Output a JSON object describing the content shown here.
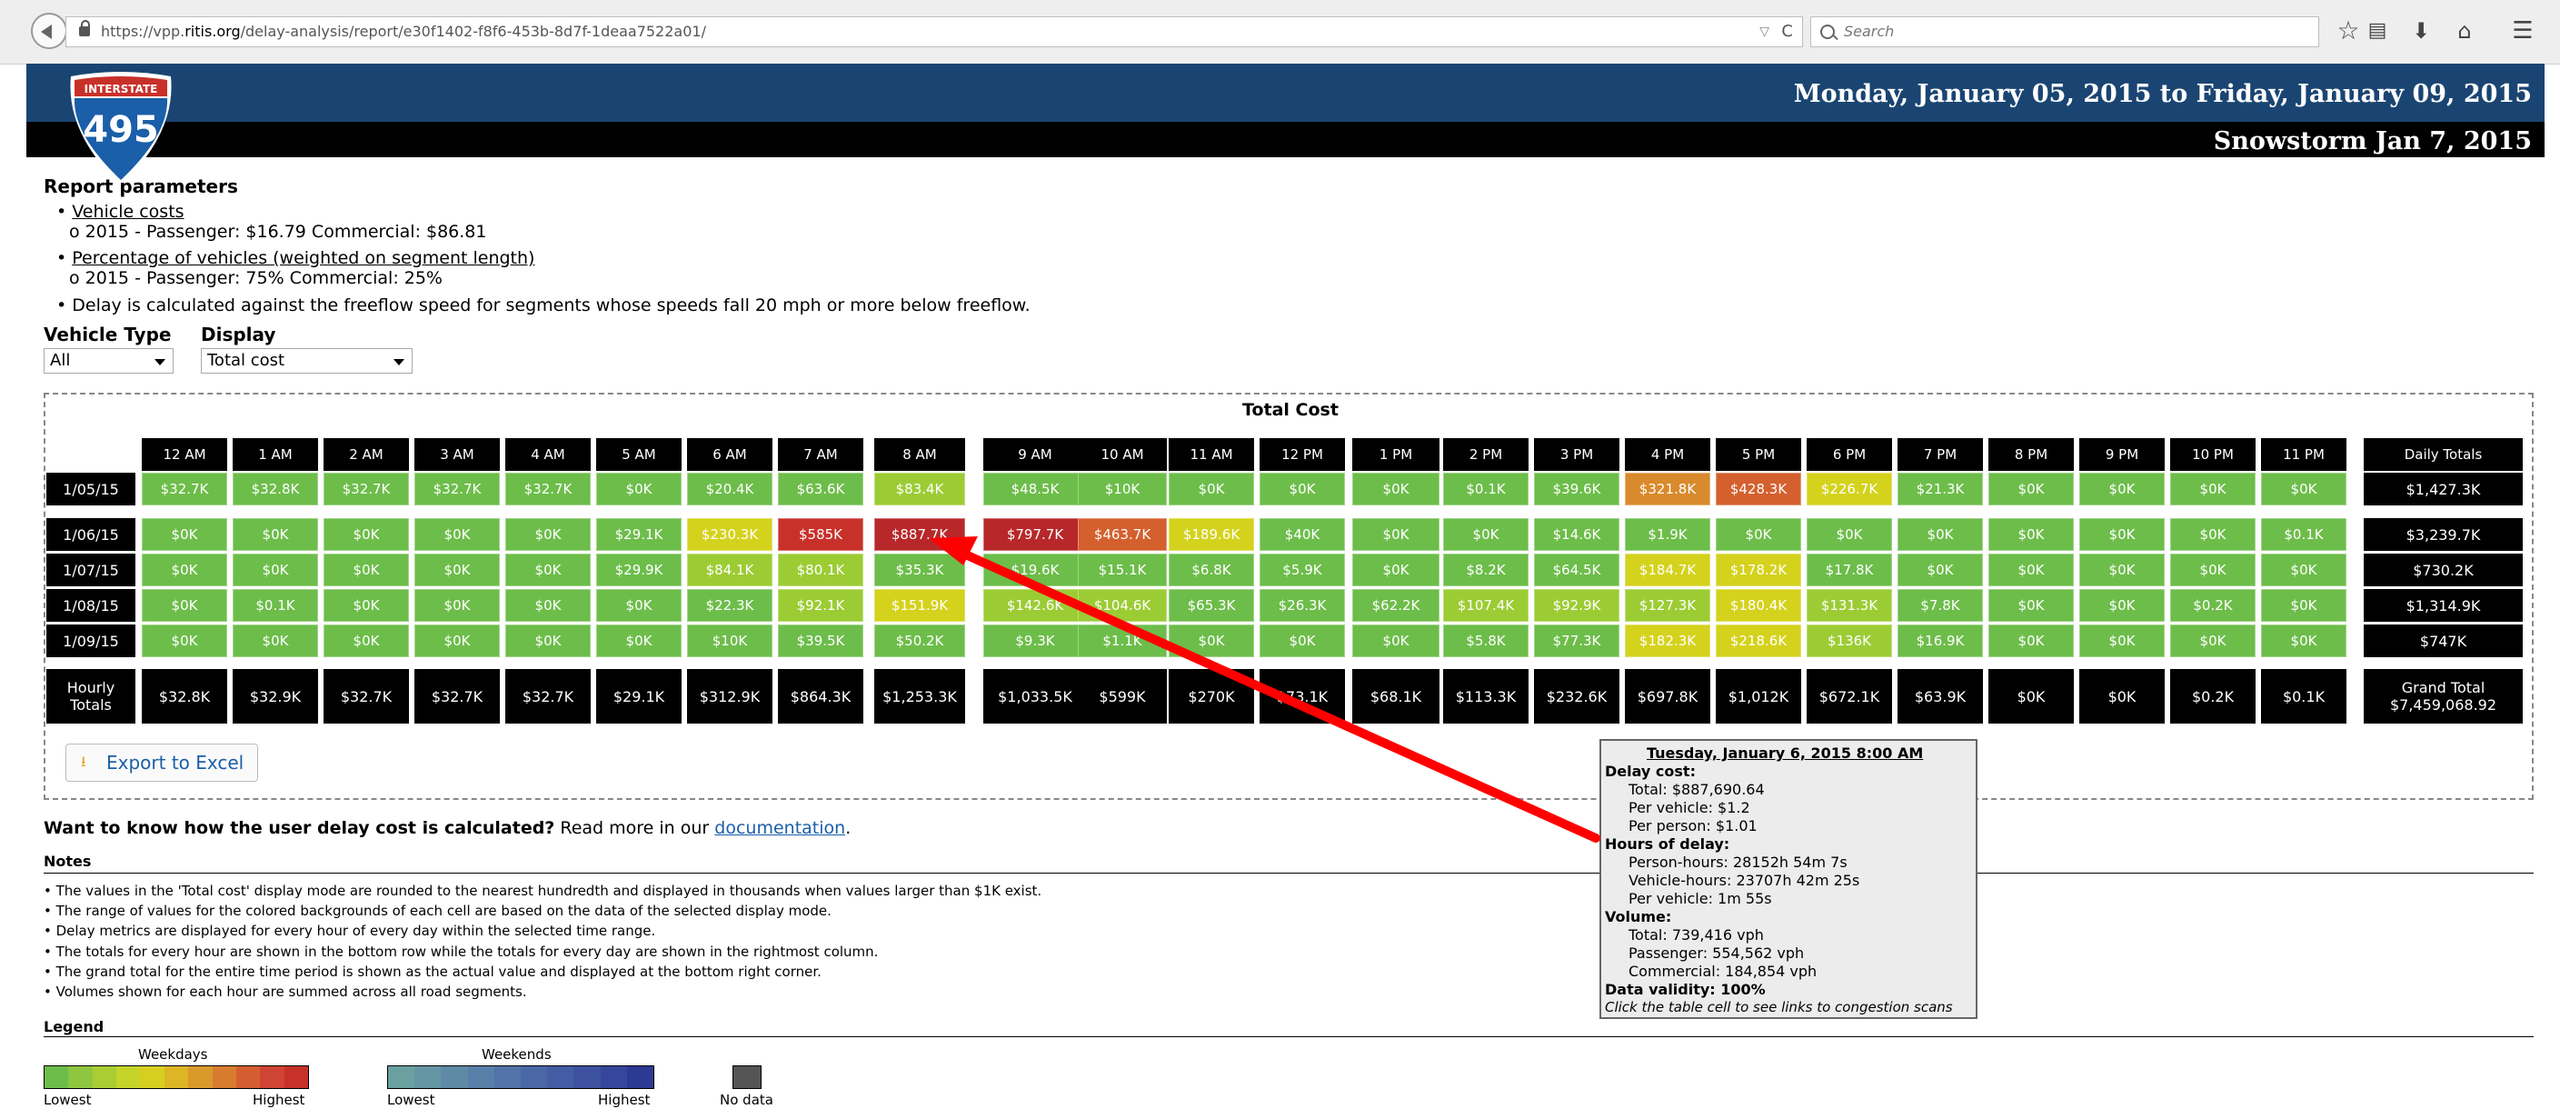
{
  "browser": {
    "url_prefix": "https://vpp.",
    "url_host": "ritis.org",
    "url_path": "/delay-analysis/report/e30f1402-f8f6-453b-8d7f-1deaa7522a01/",
    "search_placeholder": "Search",
    "reload": "C",
    "dropdown": "▽"
  },
  "header": {
    "logo_top": "INTERSTATE",
    "logo_number": "495",
    "date_range": "Monday, January 05, 2015 to Friday, January 09, 2015",
    "event_name": "Snowstorm Jan 7, 2015"
  },
  "params": {
    "title": "Report parameters",
    "vehicle_costs": "Vehicle costs",
    "vehicle_costs_detail": "2015 - Passenger: $16.79 Commercial: $86.81",
    "pct_vehicles": "Percentage of vehicles (weighted on segment length)",
    "pct_vehicles_detail": "2015 - Passenger: 75% Commercial: 25%",
    "delay_note": "Delay is calculated against the freeflow speed for segments whose speeds fall 20 mph or more below freeflow.",
    "vehicle_type_label": "Vehicle Type",
    "vehicle_type_value": "All",
    "display_label": "Display",
    "display_value": "Total cost"
  },
  "table": {
    "title": "Total Cost",
    "hours": [
      "12 AM",
      "1 AM",
      "2 AM",
      "3 AM",
      "4 AM",
      "5 AM",
      "6 AM",
      "7 AM",
      "8 AM",
      "9 AM",
      "10 AM",
      "11 AM",
      "12 PM",
      "1 PM",
      "2 PM",
      "3 PM",
      "4 PM",
      "5 PM",
      "6 PM",
      "7 PM",
      "8 PM",
      "9 PM",
      "10 PM",
      "11 PM"
    ],
    "daily_totals_header": "Daily Totals",
    "rows": [
      {
        "date": "1/05/15",
        "values": [
          "$32.7K",
          "$32.8K",
          "$32.7K",
          "$32.7K",
          "$32.7K",
          "$0K",
          "$20.4K",
          "$63.6K",
          "$83.4K",
          "$48.5K",
          "$10K",
          "$0K",
          "$0K",
          "$0K",
          "$0.1K",
          "$39.6K",
          "$321.8K",
          "$428.3K",
          "$226.7K",
          "$21.3K",
          "$0K",
          "$0K",
          "$0K",
          "$0K"
        ],
        "total": "$1,427.3K"
      },
      {
        "date": "1/06/15",
        "values": [
          "$0K",
          "$0K",
          "$0K",
          "$0K",
          "$0K",
          "$29.1K",
          "$230.3K",
          "$585K",
          "$887.7K",
          "$797.7K",
          "$463.7K",
          "$189.6K",
          "$40K",
          "$0K",
          "$0K",
          "$14.6K",
          "$1.9K",
          "$0K",
          "$0K",
          "$0K",
          "$0K",
          "$0K",
          "$0K",
          "$0.1K"
        ],
        "total": "$3,239.7K"
      },
      {
        "date": "1/07/15",
        "values": [
          "$0K",
          "$0K",
          "$0K",
          "$0K",
          "$0K",
          "$29.9K",
          "$84.1K",
          "$80.1K",
          "$35.3K",
          "$19.6K",
          "$15.1K",
          "$6.8K",
          "$5.9K",
          "$0K",
          "$8.2K",
          "$64.5K",
          "$184.7K",
          "$178.2K",
          "$17.8K",
          "$0K",
          "$0K",
          "$0K",
          "$0K",
          "$0K"
        ],
        "total": "$730.2K"
      },
      {
        "date": "1/08/15",
        "values": [
          "$0K",
          "$0.1K",
          "$0K",
          "$0K",
          "$0K",
          "$0K",
          "$22.3K",
          "$92.1K",
          "$151.9K",
          "$142.6K",
          "$104.6K",
          "$65.3K",
          "$26.3K",
          "$62.2K",
          "$107.4K",
          "$92.9K",
          "$127.3K",
          "$180.4K",
          "$131.3K",
          "$7.8K",
          "$0K",
          "$0K",
          "$0.2K",
          "$0K"
        ],
        "total": "$1,314.9K"
      },
      {
        "date": "1/09/15",
        "values": [
          "$0K",
          "$0K",
          "$0K",
          "$0K",
          "$0K",
          "$0K",
          "$10K",
          "$39.5K",
          "$50.2K",
          "$9.3K",
          "$1.1K",
          "$0K",
          "$0K",
          "$0K",
          "$5.8K",
          "$77.3K",
          "$182.3K",
          "$218.6K",
          "$136K",
          "$16.9K",
          "$0K",
          "$0K",
          "$0K",
          "$0K"
        ],
        "total": "$747K"
      }
    ],
    "hourly_totals_label_1": "Hourly",
    "hourly_totals_label_2": "Totals",
    "hourly_totals": [
      "$32.8K",
      "$32.9K",
      "$32.7K",
      "$32.7K",
      "$32.7K",
      "$29.1K",
      "$312.9K",
      "$864.3K",
      "$1,253.3K",
      "$1,033.5K",
      "$599K",
      "$270K",
      "$73.1K",
      "$68.1K",
      "$113.3K",
      "$232.6K",
      "$697.8K",
      "$1,012K",
      "$672.1K",
      "$63.9K",
      "$0K",
      "$0K",
      "$0.2K",
      "$0.1K"
    ],
    "grand_total_label": "Grand Total",
    "grand_total_value": "$7,459,068.92",
    "colors": {
      "green": "#6dbd4a",
      "lime": "#9ccc34",
      "yellow": "#d4d21c",
      "orange": "#d98a2c",
      "orange_red": "#d4602e",
      "red": "#c8312a",
      "dark_red": "#b8282a"
    }
  },
  "export": {
    "label": "Export to Excel"
  },
  "know": {
    "question": "Want to know how the user delay cost is calculated?",
    "rest": " Read more in our ",
    "link": "documentation",
    "end": "."
  },
  "notes": {
    "title": "Notes",
    "items": [
      "• The values in the 'Total cost' display mode are rounded to the nearest hundredth and displayed in thousands when values larger than $1K exist.",
      "• The range of values for the colored backgrounds of each cell are based on the data of the selected display mode.",
      "• Delay metrics are displayed for every hour of every day within the selected time range.",
      "• The totals for every hour are shown in the bottom row while the totals for every day are shown in the rightmost column.",
      "• The grand total for the entire time period is shown as the actual value and displayed at the bottom right corner.",
      "• Volumes shown for each hour are summed across all road segments."
    ]
  },
  "legend": {
    "title": "Legend",
    "weekdays": "Weekdays",
    "weekends": "Weekends",
    "lowest": "Lowest",
    "highest": "Highest",
    "no_data": "No data",
    "weekday_colors": [
      "#6dbd4a",
      "#8ec63f",
      "#a9cd33",
      "#c5d42a",
      "#d7cf1f",
      "#dcb624",
      "#d99a2b",
      "#d77c2f",
      "#d45e31",
      "#cf4432",
      "#c8312a"
    ],
    "weekend_colors": [
      "#6aa0a0",
      "#6596a4",
      "#5f8aa6",
      "#587fa8",
      "#5173a8",
      "#4a68a6",
      "#435ca3",
      "#3c519f",
      "#35469b",
      "#2c3a94"
    ],
    "no_data_color": "#555555"
  },
  "tooltip": {
    "title": "Tuesday, January 6, 2015 8:00 AM",
    "delay_cost": "Delay cost:",
    "total": "Total: $887,690.64",
    "per_vehicle": "Per vehicle: $1.2",
    "per_person": "Per person: $1.01",
    "hours_of_delay": "Hours of delay:",
    "person_hours": "Person-hours: 28152h 54m 7s",
    "vehicle_hours": "Vehicle-hours: 23707h 42m 25s",
    "per_vehicle_time": "Per vehicle: 1m 55s",
    "volume": "Volume:",
    "vol_total": "Total: 739,416 vph",
    "passenger": "Passenger: 554,562 vph",
    "commercial": "Commercial: 184,854 vph",
    "data_validity": "Data validity: 100%",
    "hint": "Click the table cell to see links to congestion scans"
  }
}
